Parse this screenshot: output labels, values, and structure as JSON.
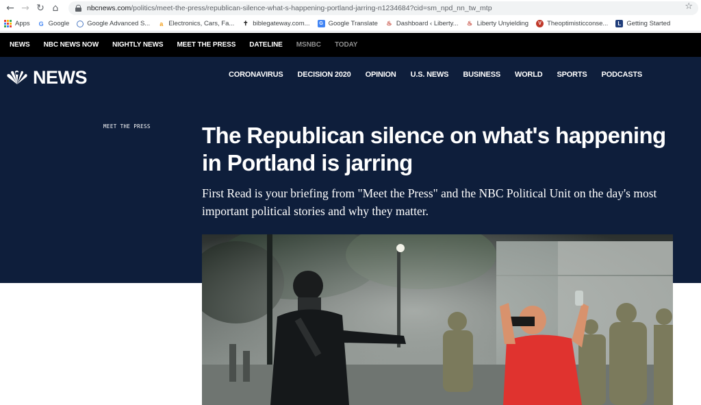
{
  "browser": {
    "url_host": "nbcnews.com",
    "url_path": "/politics/meet-the-press/republican-silence-what-s-happening-portland-jarring-n1234684?cid=sm_npd_nn_tw_mtp",
    "bookmarks": [
      {
        "label": "Apps",
        "icon": "apps-grid-icon"
      },
      {
        "label": "Google",
        "icon": "google-icon"
      },
      {
        "label": "Google Advanced S...",
        "icon": "globe-icon"
      },
      {
        "label": "Electronics, Cars, Fa...",
        "icon": "amazon-icon"
      },
      {
        "label": "biblegateway.com...",
        "icon": "biblegateway-icon"
      },
      {
        "label": "Google Translate",
        "icon": "translate-icon"
      },
      {
        "label": "Dashboard ‹ Liberty...",
        "icon": "flame-icon"
      },
      {
        "label": "Liberty Unyielding",
        "icon": "flame-icon"
      },
      {
        "label": "Theoptimisticconse...",
        "icon": "v-badge-icon"
      },
      {
        "label": "Getting Started",
        "icon": "l-badge-icon"
      }
    ]
  },
  "topnav": [
    "NEWS",
    "NBC NEWS NOW",
    "NIGHTLY NEWS",
    "MEET THE PRESS",
    "DATELINE",
    "MSNBC",
    "TODAY"
  ],
  "logo": {
    "text": "NEWS"
  },
  "mainnav": [
    "CORONAVIRUS",
    "DECISION 2020",
    "OPINION",
    "U.S. NEWS",
    "BUSINESS",
    "WORLD",
    "SPORTS",
    "PODCASTS"
  ],
  "article": {
    "section": "MEET THE PRESS",
    "headline": "The Republican silence on what's happening in Portland is jarring",
    "dek": "First Read is your briefing from \"Meet the Press\" and the NBC Political Unit on the day's most important political stories and why they matter."
  },
  "colors": {
    "hero_bg": "#0e1e3b",
    "topnav_bg": "#000000",
    "shirt_red": "#e0332f"
  }
}
